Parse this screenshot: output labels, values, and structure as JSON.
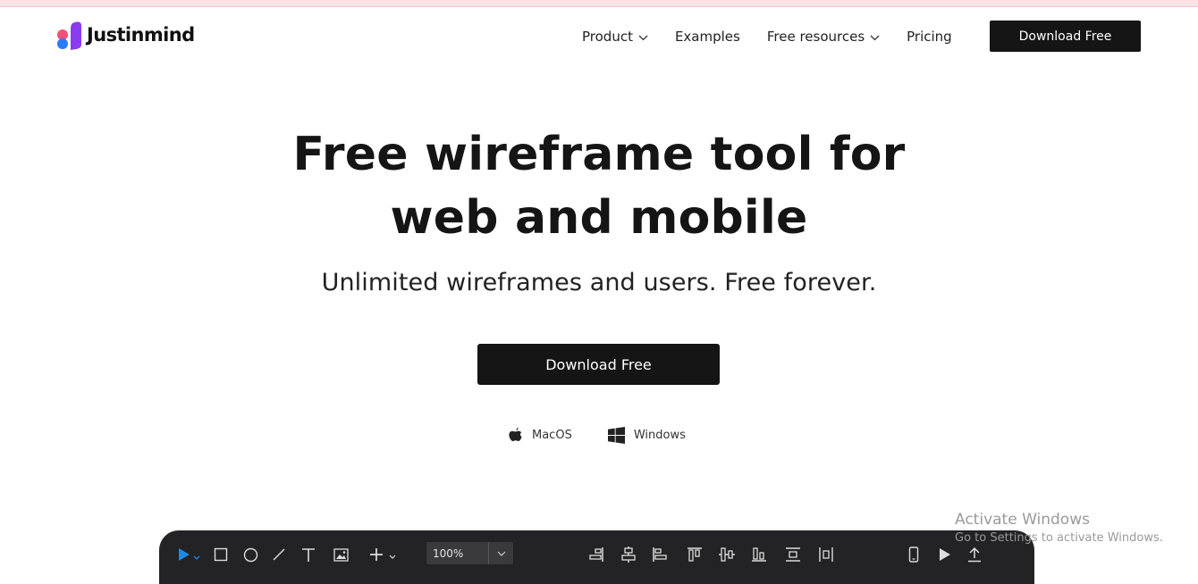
{
  "brand": {
    "name": "Justinmind",
    "colors": {
      "pink": "#f0507a",
      "purple": "#8b3cf0",
      "blue": "#2a7cf6"
    }
  },
  "nav": {
    "items": [
      {
        "label": "Product",
        "dropdown": true
      },
      {
        "label": "Examples",
        "dropdown": false
      },
      {
        "label": "Free resources",
        "dropdown": true
      },
      {
        "label": "Pricing",
        "dropdown": false
      }
    ],
    "cta_label": "Download Free"
  },
  "hero": {
    "title_line1": "Free wireframe tool for",
    "title_line2": "web and mobile",
    "subtitle": "Unlimited wireframes and users. Free forever.",
    "cta_label": "Download Free",
    "platforms": [
      {
        "label": "MacOS",
        "icon": "apple-icon"
      },
      {
        "label": "Windows",
        "icon": "windows-icon"
      }
    ]
  },
  "editor_toolbar": {
    "zoom": "100%",
    "tools": [
      "select-arrow-icon",
      "rectangle-icon",
      "ellipse-icon",
      "line-icon",
      "text-icon",
      "image-icon",
      "add-icon"
    ],
    "align_tools": [
      "align-right-icon",
      "align-center-horizontal-icon",
      "align-left-icon",
      "align-top-icon",
      "align-middle-vertical-icon",
      "align-bottom-icon",
      "distribute-vertical-icon",
      "distribute-horizontal-icon"
    ],
    "right_tools": [
      "mobile-device-icon",
      "play-simulate-icon",
      "export-upload-icon"
    ],
    "accent": "#1e88e5"
  },
  "watermark": {
    "title": "Activate Windows",
    "subtitle": "Go to Settings to activate Windows."
  }
}
